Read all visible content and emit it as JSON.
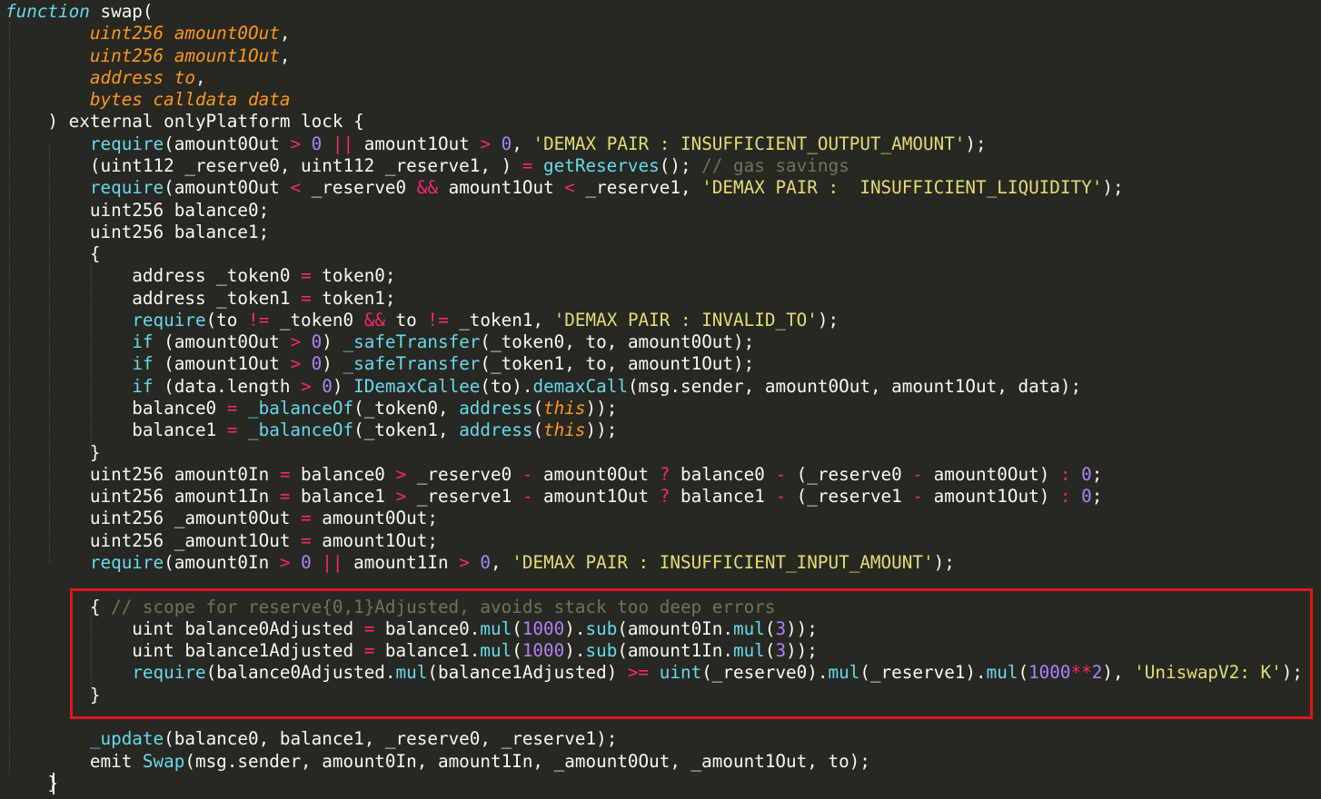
{
  "editor": {
    "language": "solidity",
    "theme_colors": {
      "background": "#272822",
      "keyword": "#66d9ef",
      "parameter": "#fd971f",
      "operator": "#f92672",
      "number": "#ae81ff",
      "string": "#e6db74",
      "comment": "#75715e",
      "text": "#f8f8f2",
      "highlight_border": "#e0161d"
    },
    "lines": [
      [
        [
          "kw",
          "function"
        ],
        [
          "plain",
          " swap("
        ]
      ],
      [
        [
          "plain",
          "        "
        ],
        [
          "param",
          "uint256 amount0Out"
        ],
        [
          "plain",
          ","
        ]
      ],
      [
        [
          "plain",
          "        "
        ],
        [
          "param",
          "uint256 amount1Out"
        ],
        [
          "plain",
          ","
        ]
      ],
      [
        [
          "plain",
          "        "
        ],
        [
          "param",
          "address to"
        ],
        [
          "plain",
          ","
        ]
      ],
      [
        [
          "plain",
          "        "
        ],
        [
          "param",
          "bytes calldata data"
        ]
      ],
      [
        [
          "plain",
          "    ) external onlyPlatform lock {"
        ]
      ],
      [
        [
          "plain",
          "        "
        ],
        [
          "call",
          "require"
        ],
        [
          "plain",
          "(amount0Out "
        ],
        [
          "op",
          ">"
        ],
        [
          "plain",
          " "
        ],
        [
          "num",
          "0"
        ],
        [
          "plain",
          " "
        ],
        [
          "op",
          "||"
        ],
        [
          "plain",
          " amount1Out "
        ],
        [
          "op",
          ">"
        ],
        [
          "plain",
          " "
        ],
        [
          "num",
          "0"
        ],
        [
          "plain",
          ", "
        ],
        [
          "str",
          "'DEMAX PAIR : INSUFFICIENT_OUTPUT_AMOUNT'"
        ],
        [
          "plain",
          ");"
        ]
      ],
      [
        [
          "plain",
          "        (uint112 _reserve0, uint112 _reserve1, ) "
        ],
        [
          "op",
          "="
        ],
        [
          "plain",
          " "
        ],
        [
          "call",
          "getReserves"
        ],
        [
          "plain",
          "(); "
        ],
        [
          "cmt",
          "// gas savings"
        ]
      ],
      [
        [
          "plain",
          "        "
        ],
        [
          "call",
          "require"
        ],
        [
          "plain",
          "(amount0Out "
        ],
        [
          "op",
          "<"
        ],
        [
          "plain",
          " _reserve0 "
        ],
        [
          "op",
          "&&"
        ],
        [
          "plain",
          " amount1Out "
        ],
        [
          "op",
          "<"
        ],
        [
          "plain",
          " _reserve1, "
        ],
        [
          "str",
          "'DEMAX PAIR :  INSUFFICIENT_LIQUIDITY'"
        ],
        [
          "plain",
          ");"
        ]
      ],
      [
        [
          "plain",
          "        uint256 balance0;"
        ]
      ],
      [
        [
          "plain",
          "        uint256 balance1;"
        ]
      ],
      [
        [
          "plain",
          "        {"
        ]
      ],
      [
        [
          "plain",
          "            address _token0 "
        ],
        [
          "op",
          "="
        ],
        [
          "plain",
          " token0;"
        ]
      ],
      [
        [
          "plain",
          "            address _token1 "
        ],
        [
          "op",
          "="
        ],
        [
          "plain",
          " token1;"
        ]
      ],
      [
        [
          "plain",
          "            "
        ],
        [
          "call",
          "require"
        ],
        [
          "plain",
          "(to "
        ],
        [
          "op",
          "!="
        ],
        [
          "plain",
          " _token0 "
        ],
        [
          "op",
          "&&"
        ],
        [
          "plain",
          " to "
        ],
        [
          "op",
          "!="
        ],
        [
          "plain",
          " _token1, "
        ],
        [
          "str",
          "'DEMAX PAIR : INVALID_TO'"
        ],
        [
          "plain",
          ");"
        ]
      ],
      [
        [
          "plain",
          "            "
        ],
        [
          "call",
          "if"
        ],
        [
          "plain",
          " (amount0Out "
        ],
        [
          "op",
          ">"
        ],
        [
          "plain",
          " "
        ],
        [
          "num",
          "0"
        ],
        [
          "plain",
          ") "
        ],
        [
          "call",
          "_safeTransfer"
        ],
        [
          "plain",
          "(_token0, to, amount0Out);"
        ]
      ],
      [
        [
          "plain",
          "            "
        ],
        [
          "call",
          "if"
        ],
        [
          "plain",
          " (amount1Out "
        ],
        [
          "op",
          ">"
        ],
        [
          "plain",
          " "
        ],
        [
          "num",
          "0"
        ],
        [
          "plain",
          ") "
        ],
        [
          "call",
          "_safeTransfer"
        ],
        [
          "plain",
          "(_token1, to, amount1Out);"
        ]
      ],
      [
        [
          "plain",
          "            "
        ],
        [
          "call",
          "if"
        ],
        [
          "plain",
          " (data.length "
        ],
        [
          "op",
          ">"
        ],
        [
          "plain",
          " "
        ],
        [
          "num",
          "0"
        ],
        [
          "plain",
          ") "
        ],
        [
          "call",
          "IDemaxCallee"
        ],
        [
          "plain",
          "(to)."
        ],
        [
          "call",
          "demaxCall"
        ],
        [
          "plain",
          "(msg.sender, amount0Out, amount1Out, data);"
        ]
      ],
      [
        [
          "plain",
          "            balance0 "
        ],
        [
          "op",
          "="
        ],
        [
          "plain",
          " "
        ],
        [
          "call",
          "_balanceOf"
        ],
        [
          "plain",
          "(_token0, "
        ],
        [
          "call",
          "address"
        ],
        [
          "plain",
          "("
        ],
        [
          "this",
          "this"
        ],
        [
          "plain",
          "));"
        ]
      ],
      [
        [
          "plain",
          "            balance1 "
        ],
        [
          "op",
          "="
        ],
        [
          "plain",
          " "
        ],
        [
          "call",
          "_balanceOf"
        ],
        [
          "plain",
          "(_token1, "
        ],
        [
          "call",
          "address"
        ],
        [
          "plain",
          "("
        ],
        [
          "this",
          "this"
        ],
        [
          "plain",
          "));"
        ]
      ],
      [
        [
          "plain",
          "        }"
        ]
      ],
      [
        [
          "plain",
          "        uint256 amount0In "
        ],
        [
          "op",
          "="
        ],
        [
          "plain",
          " balance0 "
        ],
        [
          "op",
          ">"
        ],
        [
          "plain",
          " _reserve0 "
        ],
        [
          "op",
          "-"
        ],
        [
          "plain",
          " amount0Out "
        ],
        [
          "op",
          "?"
        ],
        [
          "plain",
          " balance0 "
        ],
        [
          "op",
          "-"
        ],
        [
          "plain",
          " (_reserve0 "
        ],
        [
          "op",
          "-"
        ],
        [
          "plain",
          " amount0Out) "
        ],
        [
          "op",
          ":"
        ],
        [
          "plain",
          " "
        ],
        [
          "num",
          "0"
        ],
        [
          "plain",
          ";"
        ]
      ],
      [
        [
          "plain",
          "        uint256 amount1In "
        ],
        [
          "op",
          "="
        ],
        [
          "plain",
          " balance1 "
        ],
        [
          "op",
          ">"
        ],
        [
          "plain",
          " _reserve1 "
        ],
        [
          "op",
          "-"
        ],
        [
          "plain",
          " amount1Out "
        ],
        [
          "op",
          "?"
        ],
        [
          "plain",
          " balance1 "
        ],
        [
          "op",
          "-"
        ],
        [
          "plain",
          " (_reserve1 "
        ],
        [
          "op",
          "-"
        ],
        [
          "plain",
          " amount1Out) "
        ],
        [
          "op",
          ":"
        ],
        [
          "plain",
          " "
        ],
        [
          "num",
          "0"
        ],
        [
          "plain",
          ";"
        ]
      ],
      [
        [
          "plain",
          "        uint256 _amount0Out "
        ],
        [
          "op",
          "="
        ],
        [
          "plain",
          " amount0Out;"
        ]
      ],
      [
        [
          "plain",
          "        uint256 _amount1Out "
        ],
        [
          "op",
          "="
        ],
        [
          "plain",
          " amount1Out;"
        ]
      ],
      [
        [
          "plain",
          "        "
        ],
        [
          "call",
          "require"
        ],
        [
          "plain",
          "(amount0In "
        ],
        [
          "op",
          ">"
        ],
        [
          "plain",
          " "
        ],
        [
          "num",
          "0"
        ],
        [
          "plain",
          " "
        ],
        [
          "op",
          "||"
        ],
        [
          "plain",
          " amount1In "
        ],
        [
          "op",
          ">"
        ],
        [
          "plain",
          " "
        ],
        [
          "num",
          "0"
        ],
        [
          "plain",
          ", "
        ],
        [
          "str",
          "'DEMAX PAIR : INSUFFICIENT_INPUT_AMOUNT'"
        ],
        [
          "plain",
          ");"
        ]
      ],
      [
        [
          "plain",
          ""
        ]
      ],
      [
        [
          "plain",
          "        { "
        ],
        [
          "cmt",
          "// scope for reserve{0,1}Adjusted, avoids stack too deep errors"
        ]
      ],
      [
        [
          "plain",
          "            uint balance0Adjusted "
        ],
        [
          "op",
          "="
        ],
        [
          "plain",
          " balance0."
        ],
        [
          "call",
          "mul"
        ],
        [
          "plain",
          "("
        ],
        [
          "num",
          "1000"
        ],
        [
          "plain",
          ")."
        ],
        [
          "call",
          "sub"
        ],
        [
          "plain",
          "(amount0In."
        ],
        [
          "call",
          "mul"
        ],
        [
          "plain",
          "("
        ],
        [
          "num",
          "3"
        ],
        [
          "plain",
          "));"
        ]
      ],
      [
        [
          "plain",
          "            uint balance1Adjusted "
        ],
        [
          "op",
          "="
        ],
        [
          "plain",
          " balance1."
        ],
        [
          "call",
          "mul"
        ],
        [
          "plain",
          "("
        ],
        [
          "num",
          "1000"
        ],
        [
          "plain",
          ")."
        ],
        [
          "call",
          "sub"
        ],
        [
          "plain",
          "(amount1In."
        ],
        [
          "call",
          "mul"
        ],
        [
          "plain",
          "("
        ],
        [
          "num",
          "3"
        ],
        [
          "plain",
          "));"
        ]
      ],
      [
        [
          "plain",
          "            "
        ],
        [
          "call",
          "require"
        ],
        [
          "plain",
          "(balance0Adjusted."
        ],
        [
          "call",
          "mul"
        ],
        [
          "plain",
          "(balance1Adjusted) "
        ],
        [
          "op",
          ">="
        ],
        [
          "plain",
          " "
        ],
        [
          "call",
          "uint"
        ],
        [
          "plain",
          "(_reserve0)."
        ],
        [
          "call",
          "mul"
        ],
        [
          "plain",
          "(_reserve1)."
        ],
        [
          "call",
          "mul"
        ],
        [
          "plain",
          "("
        ],
        [
          "num",
          "1000"
        ],
        [
          "op",
          "**"
        ],
        [
          "num",
          "2"
        ],
        [
          "plain",
          "), "
        ],
        [
          "str",
          "'UniswapV2: K'"
        ],
        [
          "plain",
          ");"
        ]
      ],
      [
        [
          "plain",
          "        }"
        ]
      ],
      [
        [
          "plain",
          ""
        ]
      ],
      [
        [
          "plain",
          "        "
        ],
        [
          "call",
          "_update"
        ],
        [
          "plain",
          "(balance0, balance1, _reserve0, _reserve1);"
        ]
      ],
      [
        [
          "plain",
          "        emit "
        ],
        [
          "call",
          "Swap"
        ],
        [
          "plain",
          "(msg.sender, amount0In, amount1In, _amount0Out, _amount1Out, to);"
        ]
      ],
      [
        [
          "plain",
          "    }"
        ]
      ]
    ]
  }
}
